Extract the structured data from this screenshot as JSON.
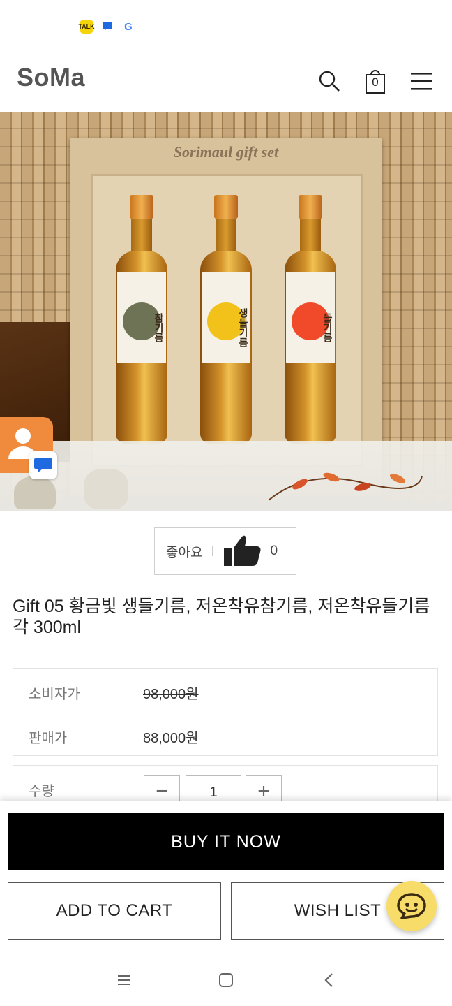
{
  "status_icons": [
    "kakaotalk-icon",
    "messages-icon",
    "google-icon"
  ],
  "status": {
    "talk_badge": "TALK",
    "google_letter": "G"
  },
  "header": {
    "logo": "SoMa",
    "cart_count": "0",
    "icons": [
      "search-icon",
      "cart-icon",
      "menu-icon"
    ]
  },
  "hero": {
    "box_title": "Sorimaul gift set",
    "bottles": [
      {
        "label": "참기름",
        "dot_color": "#6f7355"
      },
      {
        "label": "생들기름",
        "dot_color": "#f2c21a"
      },
      {
        "label": "들기름",
        "dot_color": "#f04a2a"
      }
    ]
  },
  "like": {
    "label": "좋아요",
    "count": "0"
  },
  "product": {
    "title": "Gift 05 황금빛 생들기름, 저온착유참기름, 저온착유들기름 각 300ml"
  },
  "prices": {
    "consumer_label": "소비자가",
    "consumer_value": "98,000원",
    "sale_label": "판매가",
    "sale_value": "88,000원"
  },
  "quantity": {
    "label": "수량",
    "value": "1",
    "minus": "−",
    "plus": "+"
  },
  "actions": {
    "buy_now": "BUY IT NOW",
    "add_to_cart": "ADD TO CART",
    "wish_list": "WISH LIST"
  },
  "colors": {
    "accent_black": "#000000",
    "chat_yellow": "#f7dc6a",
    "contact_orange": "#f08a3c"
  }
}
